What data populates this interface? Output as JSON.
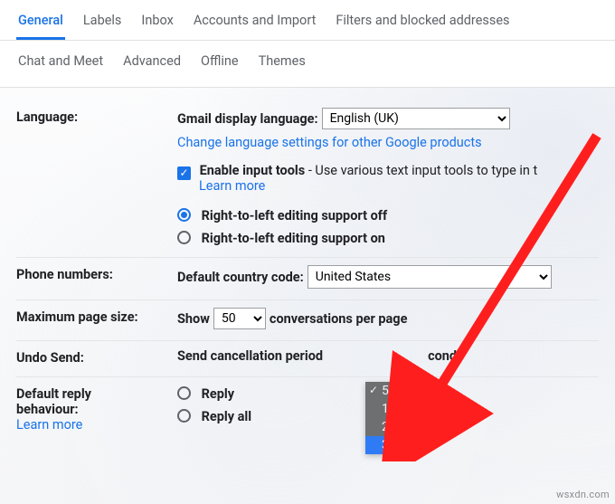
{
  "tabs": {
    "row1": [
      "General",
      "Labels",
      "Inbox",
      "Accounts and Import",
      "Filters and blocked addresses"
    ],
    "row2": [
      "Chat and Meet",
      "Advanced",
      "Offline",
      "Themes"
    ],
    "active": "General"
  },
  "language": {
    "label": "Language:",
    "display_label": "Gmail display language:",
    "display_value": "English (UK)",
    "change_link": "Change language settings for other Google products",
    "input_tools_checked": true,
    "input_tools_bold": "Enable input tools",
    "input_tools_rest": " - Use various text input tools to type in t",
    "learn_more": "Learn more",
    "rtl_off": "Right-to-left editing support off",
    "rtl_on": "Right-to-left editing support on",
    "rtl_selected": "off"
  },
  "phone": {
    "label": "Phone numbers:",
    "code_label": "Default country code:",
    "code_value": "United States"
  },
  "pagesize": {
    "label": "Maximum page size:",
    "show": "Show",
    "value": "50",
    "suffix": "conversations per page"
  },
  "undo": {
    "label": "Undo Send:",
    "period_text_a": "Send cancellation period",
    "period_text_b": "conds",
    "options": [
      "5",
      "10",
      "20",
      "30"
    ],
    "current": "5",
    "highlight": "30"
  },
  "reply": {
    "label_a": "Default reply",
    "label_b": "behaviour:",
    "opt1": "Reply",
    "opt2": "Reply all",
    "learn_more": "Learn more"
  },
  "watermark": "wsxdn.com"
}
